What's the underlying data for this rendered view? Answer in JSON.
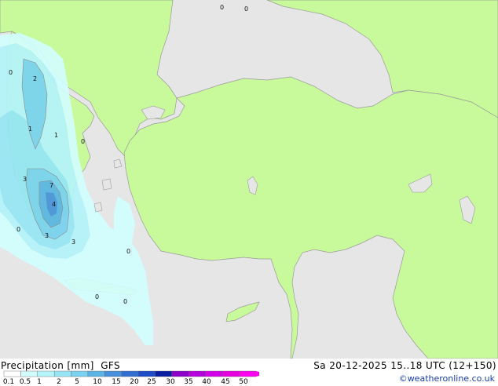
{
  "header": {
    "title": "Precipitation [mm]  GFS",
    "valid_time": "Sa 20-12-2025 15..18 UTC (12+150)",
    "credit": "©weatheronline.co.uk"
  },
  "legend": {
    "labels": [
      "0.1",
      "0.5",
      "1",
      "2",
      "5",
      "10",
      "15",
      "20",
      "25",
      "30",
      "35",
      "40",
      "45",
      "50"
    ],
    "colors": [
      "#ffffff",
      "#d2fefe",
      "#b4f4fa",
      "#96e6f6",
      "#78d2f0",
      "#5ab4e6",
      "#4690dc",
      "#326ed2",
      "#1e4cc8",
      "#0a1ea0",
      "#8c00c8",
      "#b400dc",
      "#d200e6",
      "#e600dc",
      "#ff00f0"
    ]
  },
  "colors": {
    "land": "#c8fa9b",
    "sea": "#e6e6e6",
    "coast": "#9a9a9a"
  },
  "labels": [
    {
      "text": "0"
    },
    {
      "text": "0"
    },
    {
      "text": "0"
    },
    {
      "text": "2"
    },
    {
      "text": "1"
    },
    {
      "text": "1"
    },
    {
      "text": "0"
    },
    {
      "text": "3"
    },
    {
      "text": "7"
    },
    {
      "text": "4"
    },
    {
      "text": "0"
    },
    {
      "text": "3"
    },
    {
      "text": "3"
    },
    {
      "text": "0"
    },
    {
      "text": "0"
    },
    {
      "text": "0"
    }
  ]
}
